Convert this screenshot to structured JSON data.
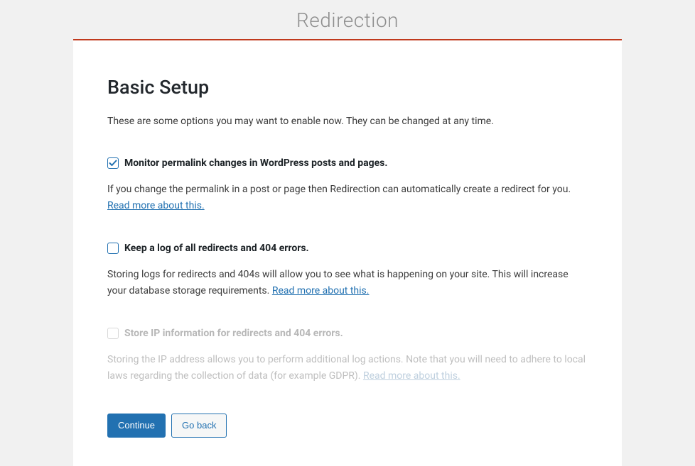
{
  "page": {
    "title": "Redirection"
  },
  "setup": {
    "heading": "Basic Setup",
    "intro": "These are some options you may want to enable now. They can be changed at any time."
  },
  "options": [
    {
      "label": "Monitor permalink changes in WordPress posts and pages.",
      "description": "If you change the permalink in a post or page then Redirection can automatically create a redirect for you. ",
      "link_text": "Read more about this.",
      "checked": true,
      "disabled": false
    },
    {
      "label": "Keep a log of all redirects and 404 errors.",
      "description": "Storing logs for redirects and 404s will allow you to see what is happening on your site. This will increase your database storage requirements. ",
      "link_text": "Read more about this.",
      "checked": false,
      "disabled": false
    },
    {
      "label": "Store IP information for redirects and 404 errors.",
      "description": "Storing the IP address allows you to perform additional log actions. Note that you will need to adhere to local laws regarding the collection of data (for example GDPR). ",
      "link_text": "Read more about this.",
      "checked": false,
      "disabled": true
    }
  ],
  "buttons": {
    "continue": "Continue",
    "back": "Go back"
  }
}
